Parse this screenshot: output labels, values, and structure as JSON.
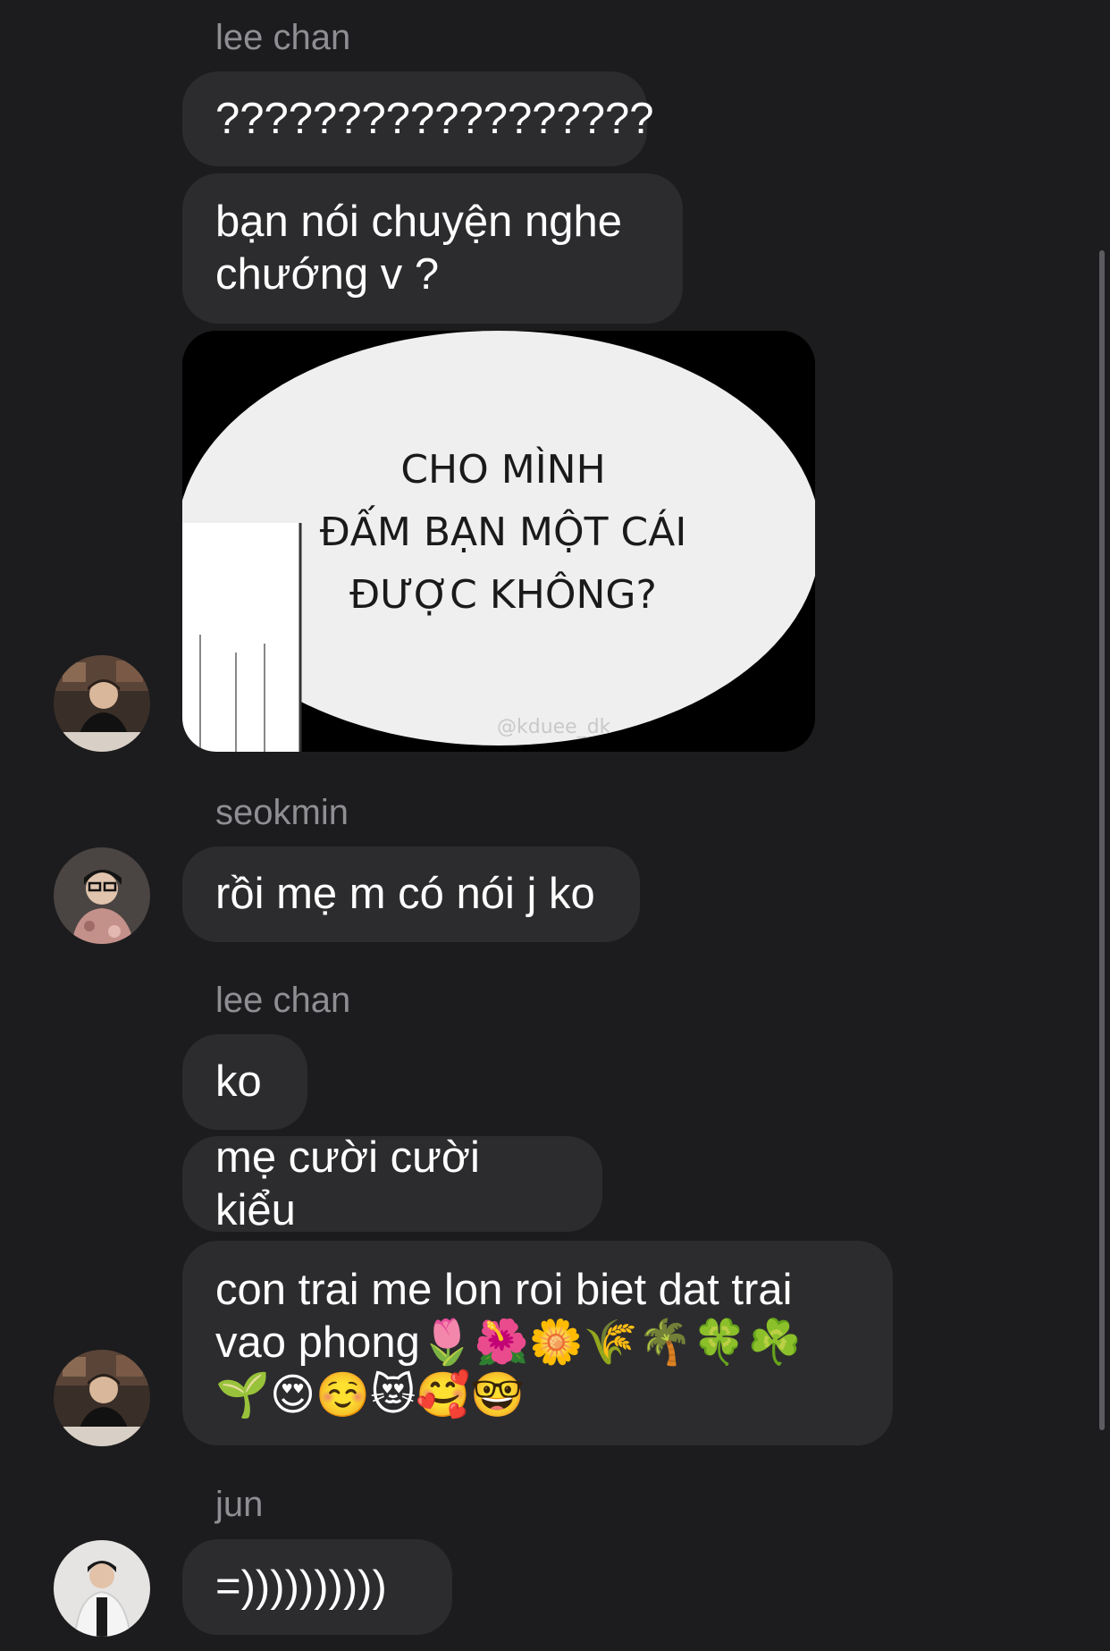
{
  "messages": [
    {
      "sender": "lee chan",
      "texts": [
        "??????????????????",
        "bạn nói chuyện nghe\nchướng v ?"
      ]
    },
    {
      "image": {
        "caption_lines": [
          "CHO MÌNH",
          "ĐẤM BẠN MỘT CÁI",
          "ĐƯỢC KHÔNG?"
        ],
        "watermark": "@kduee_dk"
      }
    },
    {
      "sender": "seokmin",
      "texts": [
        "rồi mẹ m có nói j ko"
      ]
    },
    {
      "sender": "lee chan",
      "texts": [
        "ko",
        "mẹ cười cười kiểu",
        "con trai me lon roi biet dat trai\nvao phong🌷🌺🌼🌾🌴🍀☘️\n🌱😍☺️😻🥰🤓"
      ]
    },
    {
      "sender": "jun",
      "texts": [
        "=))))))))))"
      ]
    }
  ],
  "avatars": {
    "lee_chan": "avatar-lee-chan",
    "seokmin": "avatar-seokmin",
    "jun": "avatar-jun"
  },
  "colors": {
    "background": "#1c1c1e",
    "bubble": "#2c2c2e",
    "sender_name": "#8e8e93",
    "text": "#ffffff"
  }
}
